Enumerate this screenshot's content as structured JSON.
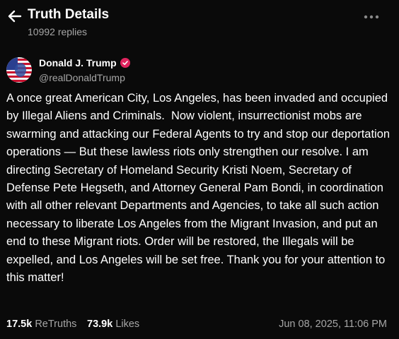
{
  "header": {
    "title": "Truth Details",
    "replies": "10992 replies",
    "back_icon": "arrow-left-icon",
    "more_icon": "more-horizontal-icon"
  },
  "author": {
    "name": "Donald J. Trump",
    "handle": "@realDonaldTrump",
    "verified_icon": "verified-badge-icon",
    "verified_color": "#e0245e"
  },
  "post": {
    "text": "A once great American City, Los Angeles, has been invaded and occupied by Illegal Aliens and Criminals.  Now violent, insurrectionist mobs are swarming and attacking our Federal Agents to try and stop our deportation operations — But these lawless riots only strengthen our resolve. I am directing Secretary of Homeland Security Kristi Noem, Secretary of Defense Pete Hegseth, and Attorney General Pam Bondi, in coordination with all other relevant Departments and Agencies, to take all such action necessary to liberate Los Angeles from the Migrant Invasion, and put an end to these Migrant riots. Order will be restored, the Illegals will be expelled, and Los Angeles will be set free. Thank you for your attention to this matter!"
  },
  "footer": {
    "retruths_count": "17.5k",
    "retruths_label": "ReTruths",
    "likes_count": "73.9k",
    "likes_label": "Likes",
    "timestamp": "Jun 08, 2025, 11:06 PM"
  },
  "colors": {
    "background": "#0a0a0a",
    "text": "#ffffff",
    "muted": "#a6a6a6"
  }
}
